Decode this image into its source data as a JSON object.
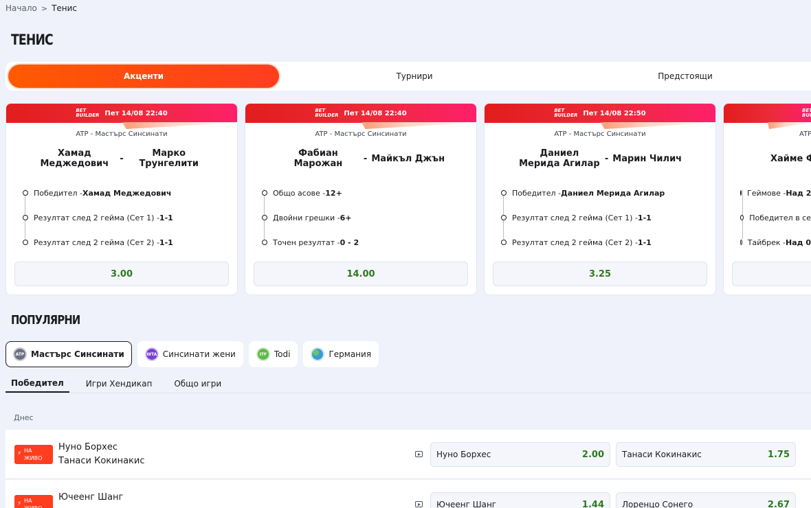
{
  "breadcrumb": {
    "home": "Начало",
    "current": "Тенис"
  },
  "page_title": "ТЕНИС",
  "tabs": [
    {
      "label": "Акценти"
    },
    {
      "label": "Турнири"
    },
    {
      "label": "Предстоящи"
    }
  ],
  "bet_builder_logo": "BET\nBUILDER",
  "cards": [
    {
      "date": "Пет 14/08 22:40",
      "league": "ATP - Мастърс Синсинати",
      "player1": "Хамад Меджедович",
      "player2": "Марко Трунгелити",
      "legs": [
        {
          "market": "Победител - ",
          "value": "Хамад Меджедович"
        },
        {
          "market": "Резултат след 2 гейма (Сет 1) - ",
          "value": "1-1"
        },
        {
          "market": "Резултат след 2 гейма (Сет 2) - ",
          "value": "1-1"
        }
      ],
      "odd": "3.00"
    },
    {
      "date": "Пет 14/08 22:40",
      "league": "ATP - Мастърс Синсинати",
      "player1": "Фабиан Марожан",
      "player2": "Майкъл Джън",
      "legs": [
        {
          "market": "Общо асове - ",
          "value": "12+"
        },
        {
          "market": "Двойни грешки - ",
          "value": "6+"
        },
        {
          "market": "Точен резултат - ",
          "value": "0 - 2"
        }
      ],
      "odd": "14.00"
    },
    {
      "date": "Пет 14/08 22:50",
      "league": "ATP - Мастърс Синсинати",
      "player1": "Даниел Мерида Агилар",
      "player2": "Марин Чилич",
      "legs": [
        {
          "market": "Победител - ",
          "value": "Даниел Мерида Агилар"
        },
        {
          "market": "Резултат след 2 гейма (Сет 1) - ",
          "value": "1-1"
        },
        {
          "market": "Резултат след 2 гейма (Сет 2) - ",
          "value": "1-1"
        }
      ],
      "odd": "3.25"
    },
    {
      "date": "",
      "league": "ATP",
      "player1": "Хайме Ф",
      "player2": "",
      "legs": [
        {
          "market": "Геймове - ",
          "value": "Над 2"
        },
        {
          "market": "Победител в се",
          "value": ""
        },
        {
          "market": "Тайбрек - ",
          "value": "Над 0"
        }
      ],
      "odd": ""
    }
  ],
  "popular_title": "ПОПУЛЯРНИ",
  "chips": [
    {
      "label": "Мастърс Синсинати",
      "icon_text": "ATP",
      "icon": "atp-logo-icon",
      "color": "#6b7180"
    },
    {
      "label": "Синсинати жени",
      "icon_text": "WTA",
      "icon": "wta-logo-icon",
      "color": "#7b3fd0"
    },
    {
      "label": "Todi",
      "icon_text": "ITF",
      "icon": "itf-logo-icon",
      "color": "#5fb84a"
    },
    {
      "label": "Германия",
      "icon_text": "",
      "icon": "globe-icon",
      "color": "#3a9bd5"
    }
  ],
  "market_tabs": [
    {
      "label": "Победител"
    },
    {
      "label": "Игри Хендикап"
    },
    {
      "label": "Общо игри"
    }
  ],
  "day_label": "Днес",
  "live_label": "НА\nЖИВО",
  "events": [
    {
      "team1": "Нуно Борхес",
      "team2": "Танаси Кокинакис",
      "odd1_label": "Нуно Борхес",
      "odd1": "2.00",
      "odd2_label": "Танаси Кокинакис",
      "odd2": "1.75"
    },
    {
      "team1": "Ючеенг Шанг",
      "team2": "",
      "odd1_label": "Ючеенг Шанг",
      "odd1": "1.44",
      "odd2_label": "Лоренцо Сонего",
      "odd2": "2.67"
    }
  ],
  "colors": {
    "accent": "#ff4a12",
    "odds_green": "#2c7a1e",
    "live": "#ff3d1f"
  }
}
